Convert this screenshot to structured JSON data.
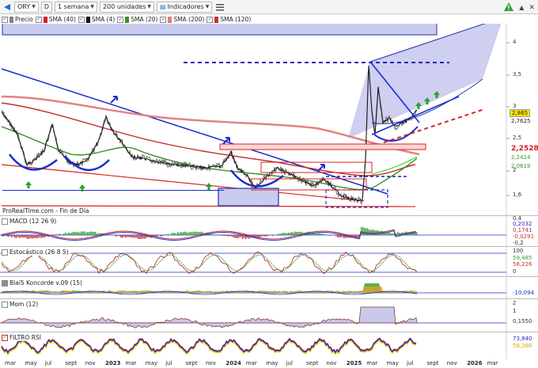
{
  "toolbar": {
    "ticker": "ORY",
    "d_label": "D",
    "period": "1 semana",
    "units": "200 unidades",
    "indicators": "Indicadores",
    "icons": [
      "back-arrow-icon",
      "list-icon",
      "warning-icon",
      "caret-up-icon",
      "x-mark-icon"
    ]
  },
  "legend": {
    "items": [
      {
        "label": "Precio",
        "color": "#808080"
      },
      {
        "label": "SMA (40)",
        "color": "#d32222"
      },
      {
        "label": "SMA (4)",
        "color": "#111111"
      },
      {
        "label": "SMA (20)",
        "color": "#3d8f1e"
      },
      {
        "label": "SMA (200)",
        "color": "#e07b7b"
      },
      {
        "label": "SMA (120)",
        "color": "#c83030"
      }
    ]
  },
  "main": {
    "source": "ProRealTime.com - Fin de Día",
    "y_ticks": [
      "4",
      "3,5",
      "3",
      "2,5",
      "2",
      "1,6"
    ],
    "tags": [
      {
        "text": "2,865",
        "bg": "#ffe200",
        "color": "#000000"
      },
      {
        "text": "2,7625",
        "bg": "#ffffff",
        "color": "#000000"
      },
      {
        "text": "2,2528",
        "bg": "#ffffff",
        "color": "#d02020"
      },
      {
        "text": "2,2414",
        "bg": "#ffffff",
        "color": "#3d8f1e"
      },
      {
        "text": "2,0619",
        "bg": "#ffffff",
        "color": "#3d8f1e"
      }
    ]
  },
  "macd": {
    "title": "MACD (12 26 9)",
    "values": [
      "0,2032",
      "0,1741",
      "-0,0291"
    ],
    "ticks": [
      "0,4",
      "0,2",
      "0",
      "-0,2"
    ]
  },
  "stoch": {
    "title": "Estocástico (26 8 5)",
    "values": [
      "59,485",
      "58,226"
    ],
    "ticks": [
      "100",
      "50",
      "0"
    ]
  },
  "blai": {
    "title": "Blai5 Koncorde v.09 (15)",
    "values": [
      "-10,094"
    ]
  },
  "mom": {
    "title": "Mom (12)",
    "values": [
      "0,1550"
    ],
    "ticks": [
      "2",
      "1",
      "0"
    ]
  },
  "filtro": {
    "title": "FILTRO RSI",
    "values": [
      "73,840",
      "58,386"
    ]
  },
  "xaxis": {
    "labels": [
      "mar",
      "may",
      "jul",
      "sept",
      "nov",
      "2023",
      "mar",
      "may",
      "jul",
      "sept",
      "nov",
      "2024",
      "mar",
      "may",
      "jul",
      "sept",
      "nov",
      "2025",
      "mar",
      "may",
      "jul",
      "sept",
      "nov",
      "2026",
      "mar"
    ]
  }
}
